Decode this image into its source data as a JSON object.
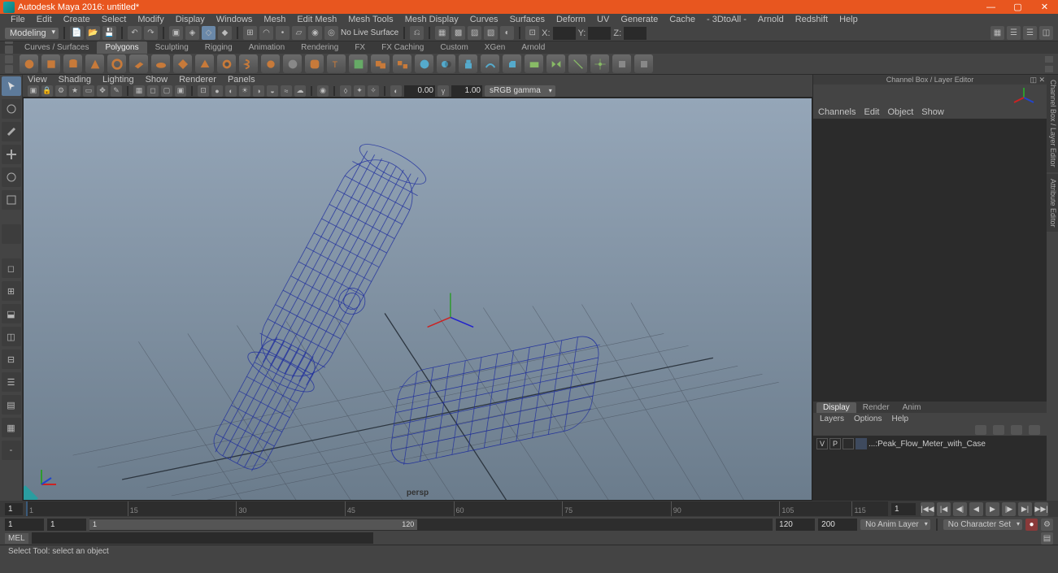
{
  "titlebar": {
    "text": "Autodesk Maya 2016: untitled*"
  },
  "menubar": [
    "File",
    "Edit",
    "Create",
    "Select",
    "Modify",
    "Display",
    "Windows",
    "Mesh",
    "Edit Mesh",
    "Mesh Tools",
    "Mesh Display",
    "Curves",
    "Surfaces",
    "Deform",
    "UV",
    "Generate",
    "Cache",
    "- 3DtoAll -",
    "Arnold",
    "Redshift",
    "Help"
  ],
  "status": {
    "mode": "Modeling",
    "no_live": "No Live Surface",
    "coord_labels": {
      "x": "X:",
      "y": "Y:",
      "z": "Z:"
    }
  },
  "shelf_tabs": [
    "Curves / Surfaces",
    "Polygons",
    "Sculpting",
    "Rigging",
    "Animation",
    "Rendering",
    "FX",
    "FX Caching",
    "Custom",
    "XGen",
    "Arnold"
  ],
  "shelf_active": "Polygons",
  "panel_menus": [
    "View",
    "Shading",
    "Lighting",
    "Show",
    "Renderer",
    "Panels"
  ],
  "panel_toolbar": {
    "num1": "0.00",
    "num2": "1.00",
    "gamma": "sRGB gamma"
  },
  "viewport": {
    "camera_label": "persp"
  },
  "channelbox": {
    "header": "Channel Box / Layer Editor",
    "menus": [
      "Channels",
      "Edit",
      "Object",
      "Show"
    ]
  },
  "side_tabs": [
    "Channel Box / Layer Editor",
    "Attribute Editor"
  ],
  "layer_editor": {
    "tabs": [
      "Display",
      "Render",
      "Anim"
    ],
    "active_tab": "Display",
    "menus": [
      "Layers",
      "Options",
      "Help"
    ],
    "layer": {
      "v": "V",
      "p": "P",
      "name": "...:Peak_Flow_Meter_with_Case"
    }
  },
  "timeline": {
    "ticks": [
      1,
      15,
      30,
      45,
      60,
      75,
      90,
      105,
      115,
      120
    ],
    "mid_ticks": [
      60,
      105,
      150,
      195,
      245,
      290,
      335,
      380,
      425,
      475,
      520,
      565,
      610,
      655,
      700,
      750,
      795,
      840,
      885,
      930,
      975,
      1020,
      1065,
      1110
    ],
    "current_frame": "1",
    "start_left": "1",
    "range_start": "1",
    "range_inner_start": "1",
    "range_inner_end": "120",
    "range_end": "120",
    "end_right": "200",
    "anim_layer": "No Anim Layer",
    "char_set": "No Character Set"
  },
  "cmd": {
    "label": "MEL"
  },
  "help_line": "Select Tool: select an object"
}
